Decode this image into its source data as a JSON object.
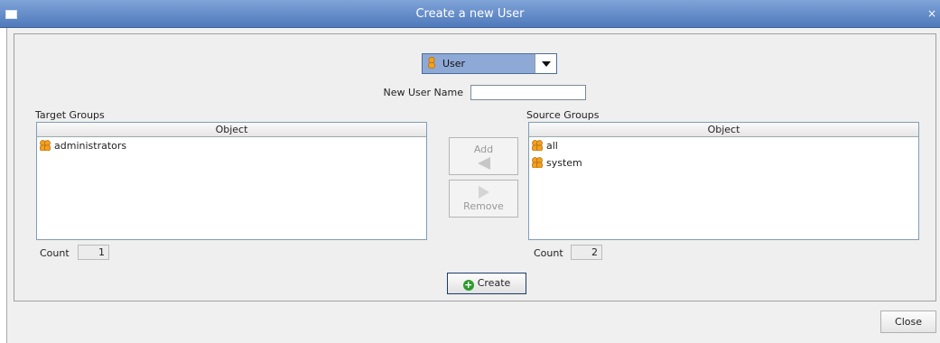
{
  "window": {
    "title": "Create a new User",
    "close_glyph": "×"
  },
  "type_selector": {
    "selected": "User",
    "icon": "user-icon"
  },
  "new_user": {
    "label": "New User Name",
    "value": ""
  },
  "target_groups": {
    "title": "Target Groups",
    "column": "Object",
    "rows": [
      "administrators"
    ],
    "count_label": "Count",
    "count": "1"
  },
  "source_groups": {
    "title": "Source Groups",
    "column": "Object",
    "rows": [
      "all",
      "system"
    ],
    "count_label": "Count",
    "count": "2"
  },
  "buttons": {
    "add": "Add",
    "remove": "Remove",
    "create": "Create",
    "close": "Close"
  },
  "colors": {
    "titlebar": "#5d85c6",
    "selection": "#8fa9d6",
    "icon_orange": "#f2a01e"
  }
}
